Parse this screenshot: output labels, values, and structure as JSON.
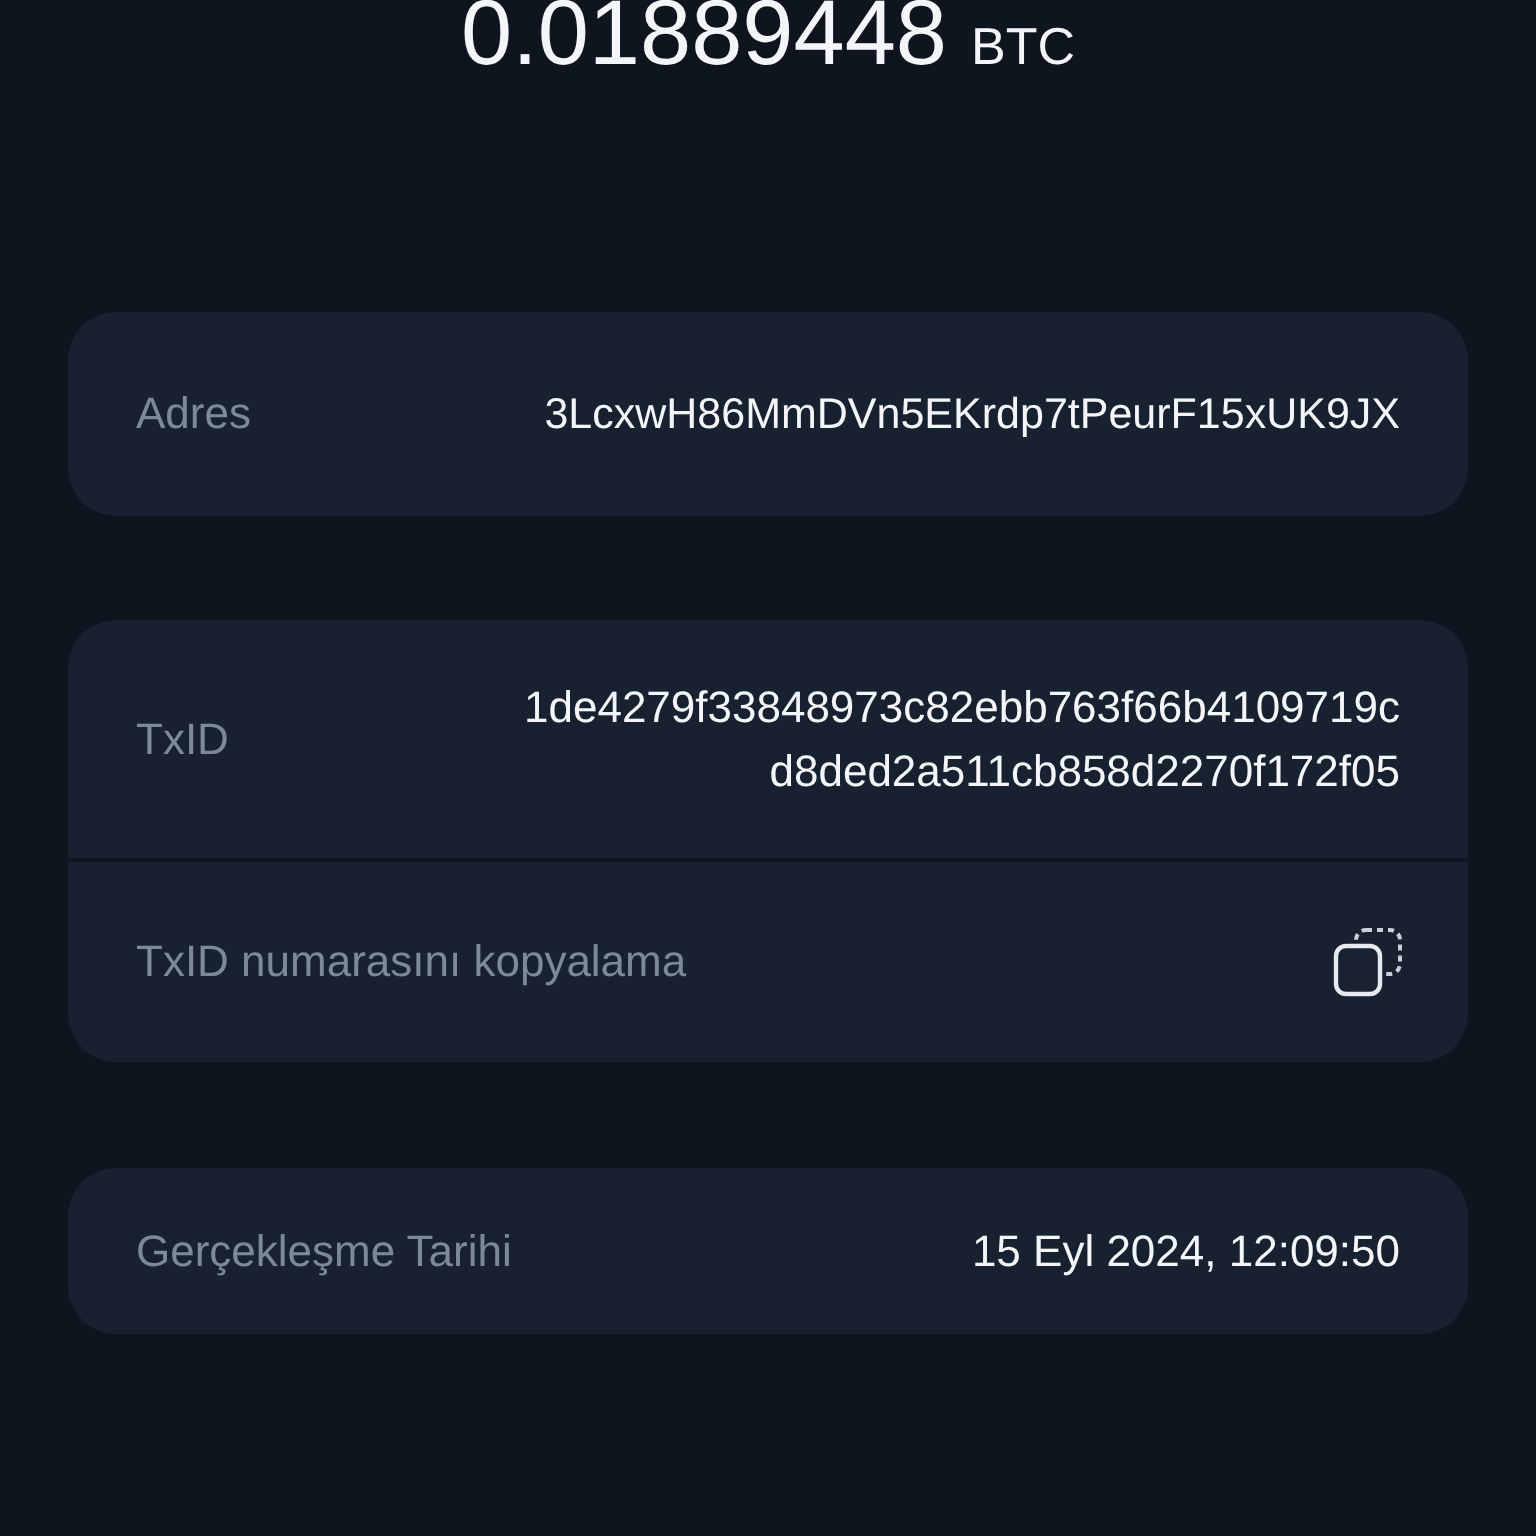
{
  "amount": {
    "value": "0.01889448",
    "unit": "BTC"
  },
  "address": {
    "label": "Adres",
    "value": "3LcxwH86MmDVn5EKrdp7tPeurF15xUK9JX"
  },
  "txid": {
    "label": "TxID",
    "lines": [
      "1de4279f33848973c82ebb763f66b4109719c",
      "d8ded2a511cb858d2270f172f05"
    ],
    "copy_label": "TxID numarasını kopyalama"
  },
  "date": {
    "label": "Gerçekleşme Tarihi",
    "value": "15 Eyl 2024, 12:09:50"
  }
}
